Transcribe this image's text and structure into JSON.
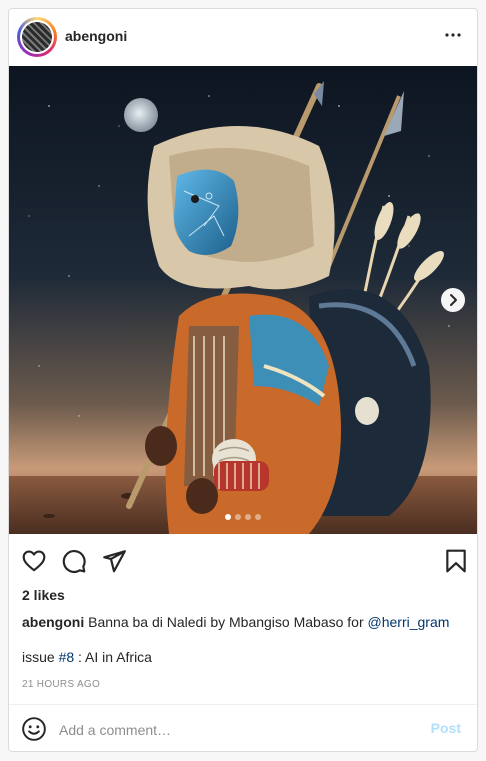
{
  "post": {
    "username": "abengoni",
    "likes": "2 likes",
    "caption": {
      "username": "abengoni",
      "text": " Banna ba di Naledi by Mbangiso Mabaso for ",
      "mention": "@herri_gram"
    },
    "issue_prefix": "issue ",
    "issue_tag": "#8",
    "issue_suffix": " : AI in Africa",
    "timestamp": "21 HOURS AGO",
    "carousel": {
      "slides": 4,
      "active_index": 0
    }
  },
  "comment": {
    "placeholder": "Add a comment…",
    "post_label": "Post"
  },
  "icons": {
    "more": "more-options-icon",
    "next": "chevron-right-icon",
    "like": "heart-icon",
    "comment": "comment-icon",
    "share": "share-icon",
    "save": "bookmark-icon",
    "emoji": "emoji-icon"
  },
  "colors": {
    "link": "#00376b",
    "post_disabled": "#b2dffc",
    "muted": "#8e8e8e"
  }
}
